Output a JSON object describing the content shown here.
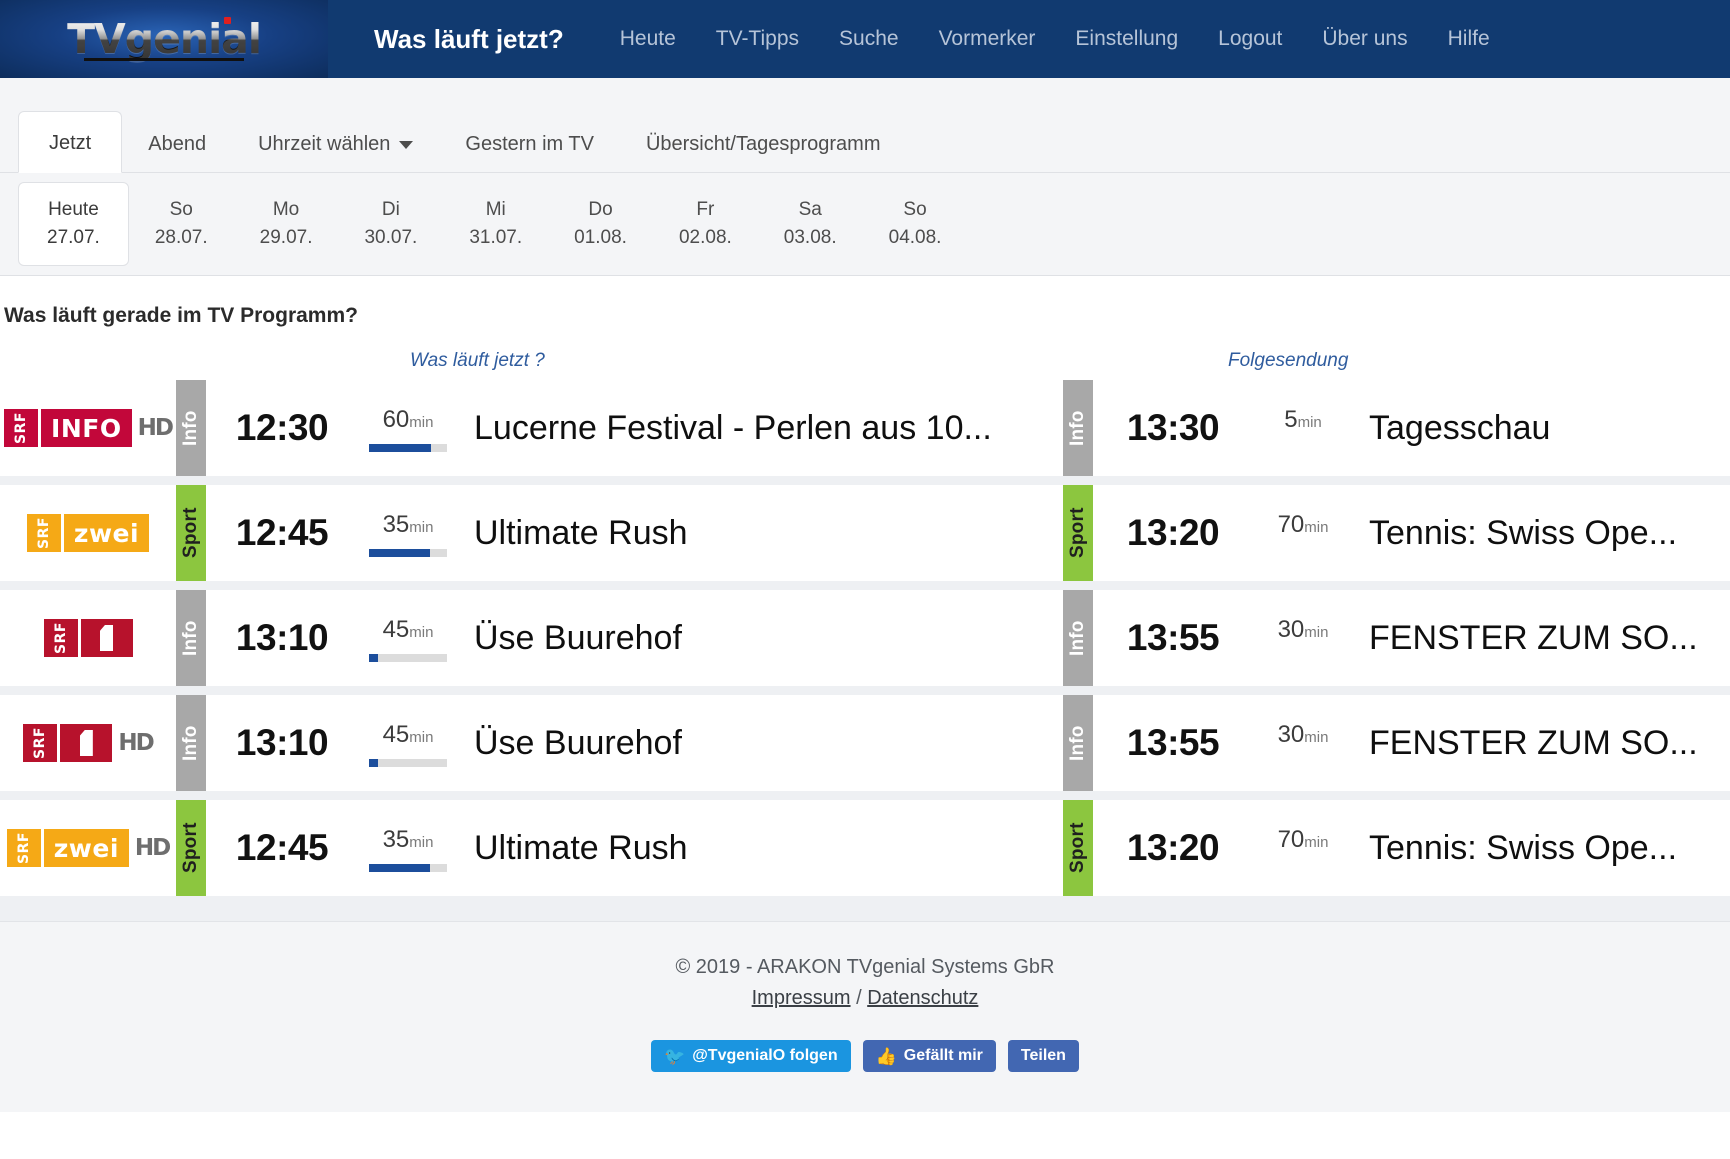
{
  "header": {
    "logo_text": "TVgenial",
    "logo_icon": "tvgenial-logo",
    "title": "Was läuft jetzt?",
    "nav": [
      {
        "label": "Heute"
      },
      {
        "label": "TV-Tipps"
      },
      {
        "label": "Suche"
      },
      {
        "label": "Vormerker"
      },
      {
        "label": "Einstellung"
      },
      {
        "label": "Logout"
      },
      {
        "label": "Über uns"
      },
      {
        "label": "Hilfe"
      }
    ]
  },
  "tabs": [
    {
      "label": "Jetzt",
      "active": true
    },
    {
      "label": "Abend",
      "active": false
    },
    {
      "label": "Uhrzeit wählen",
      "active": false,
      "caret": true
    },
    {
      "label": "Gestern im TV",
      "active": false
    },
    {
      "label": "Übersicht/Tagesprogramm",
      "active": false
    }
  ],
  "dates": [
    {
      "day": "Heute",
      "date": "27.07.",
      "today": true
    },
    {
      "day": "So",
      "date": "28.07.",
      "today": false
    },
    {
      "day": "Mo",
      "date": "29.07.",
      "today": false
    },
    {
      "day": "Di",
      "date": "30.07.",
      "today": false
    },
    {
      "day": "Mi",
      "date": "31.07.",
      "today": false
    },
    {
      "day": "Do",
      "date": "01.08.",
      "today": false
    },
    {
      "day": "Fr",
      "date": "02.08.",
      "today": false
    },
    {
      "day": "Sa",
      "date": "03.08.",
      "today": false
    },
    {
      "day": "So",
      "date": "04.08.",
      "today": false
    }
  ],
  "section": {
    "heading": "Was läuft gerade im TV Programm?"
  },
  "columns": {
    "now": "Was läuft jetzt ?",
    "next": "Folgesendung"
  },
  "rows": [
    {
      "channel": {
        "name": "SRF INFO HD",
        "style": "ch-red",
        "word": "INFO",
        "hd": "HD",
        "one": false
      },
      "now": {
        "genre": "Info",
        "genre_style": "info",
        "time": "12:30",
        "duration": "60",
        "unit": "min",
        "progress": 80,
        "title": "Lucerne Festival - Perlen aus 10..."
      },
      "next": {
        "genre": "Info",
        "genre_style": "info",
        "time": "13:30",
        "duration": "5",
        "unit": "min",
        "progress": null,
        "title": "Tagesschau"
      }
    },
    {
      "channel": {
        "name": "SRF zwei",
        "style": "ch-amb",
        "word": "zwei",
        "hd": "",
        "one": false
      },
      "now": {
        "genre": "Sport",
        "genre_style": "sport",
        "time": "12:45",
        "duration": "35",
        "unit": "min",
        "progress": 78,
        "title": "Ultimate Rush"
      },
      "next": {
        "genre": "Sport",
        "genre_style": "sport",
        "time": "13:20",
        "duration": "70",
        "unit": "min",
        "progress": null,
        "title": "Tennis: Swiss Ope..."
      }
    },
    {
      "channel": {
        "name": "SRF 1",
        "style": "ch-crim",
        "word": "",
        "hd": "",
        "one": true
      },
      "now": {
        "genre": "Info",
        "genre_style": "info",
        "time": "13:10",
        "duration": "45",
        "unit": "min",
        "progress": 12,
        "title": "Üse Buurehof"
      },
      "next": {
        "genre": "Info",
        "genre_style": "info",
        "time": "13:55",
        "duration": "30",
        "unit": "min",
        "progress": null,
        "title": "FENSTER ZUM SO..."
      }
    },
    {
      "channel": {
        "name": "SRF 1 HD",
        "style": "ch-crim",
        "word": "",
        "hd": "HD",
        "one": true
      },
      "now": {
        "genre": "Info",
        "genre_style": "info",
        "time": "13:10",
        "duration": "45",
        "unit": "min",
        "progress": 12,
        "title": "Üse Buurehof"
      },
      "next": {
        "genre": "Info",
        "genre_style": "info",
        "time": "13:55",
        "duration": "30",
        "unit": "min",
        "progress": null,
        "title": "FENSTER ZUM SO..."
      }
    },
    {
      "channel": {
        "name": "SRF zwei HD",
        "style": "ch-amb",
        "word": "zwei",
        "hd": "HD",
        "one": false
      },
      "now": {
        "genre": "Sport",
        "genre_style": "sport",
        "time": "12:45",
        "duration": "35",
        "unit": "min",
        "progress": 78,
        "title": "Ultimate Rush"
      },
      "next": {
        "genre": "Sport",
        "genre_style": "sport",
        "time": "13:20",
        "duration": "70",
        "unit": "min",
        "progress": null,
        "title": "Tennis: Swiss Ope..."
      }
    }
  ],
  "footer": {
    "copyright": "© 2019 - ARAKON TVgenial Systems GbR",
    "impressum": "Impressum",
    "separator": " / ",
    "datenschutz": "Datenschutz",
    "twitter": {
      "label": "@TvgenialO folgen",
      "icon": "twitter-bird-icon"
    },
    "facebook_like": {
      "label": "Gefällt mir",
      "icon": "thumbs-up-icon"
    },
    "facebook_share": {
      "label": "Teilen"
    }
  },
  "colors": {
    "brand_blue": "#113a70",
    "accent_blue": "#1c4e9c",
    "genre_info": "#a8a8a8",
    "genre_sport": "#8cc63f",
    "srf_red": "#c2073a",
    "srf_amber": "#f5a916"
  }
}
